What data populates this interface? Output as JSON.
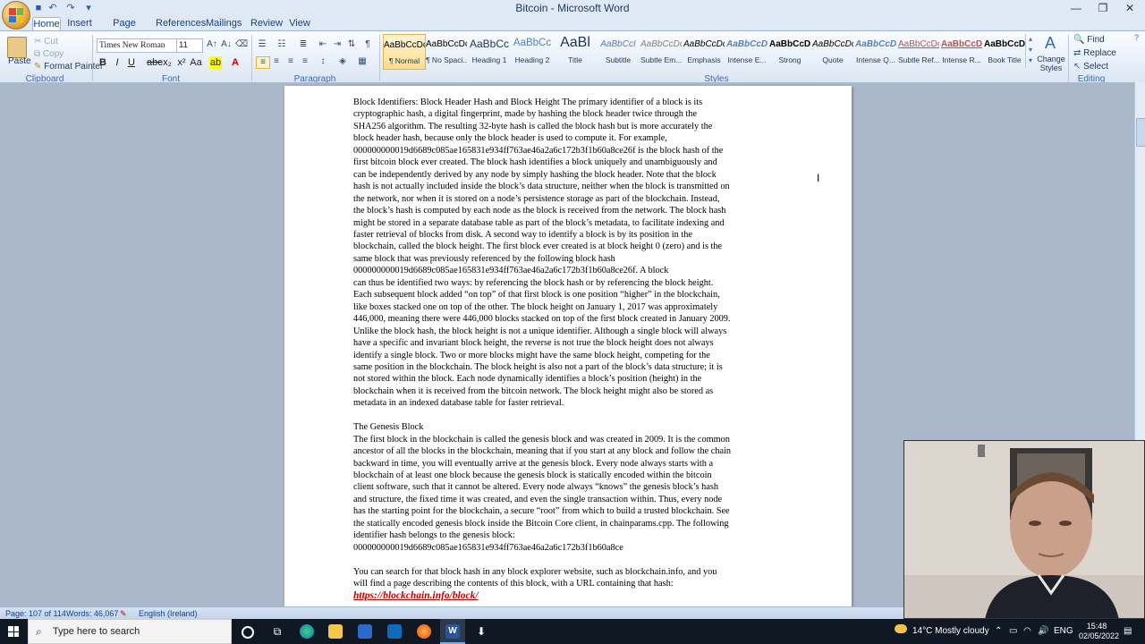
{
  "window": {
    "title": "Bitcoin - Microsoft Word"
  },
  "tabs": [
    {
      "label": "Home",
      "active": true
    },
    {
      "label": "Insert"
    },
    {
      "label": "Page Layout"
    },
    {
      "label": "References"
    },
    {
      "label": "Mailings"
    },
    {
      "label": "Review"
    },
    {
      "label": "View"
    }
  ],
  "clipboard": {
    "paste": "Paste",
    "cut": "Cut",
    "copy": "Copy",
    "format_painter": "Format Painter",
    "label": "Clipboard"
  },
  "font": {
    "name": "Times New Roman",
    "size": "11",
    "label": "Font",
    "bold": "B",
    "italic": "I",
    "underline": "U"
  },
  "paragraph": {
    "label": "Paragraph"
  },
  "styles": {
    "label": "Styles",
    "items": [
      {
        "sample": "AaBbCcDc",
        "name": "¶ Normal",
        "selected": true
      },
      {
        "sample": "AaBbCcDc",
        "name": "¶ No Spaci..."
      },
      {
        "sample": "AaBbCc",
        "name": "Heading 1"
      },
      {
        "sample": "AaBbCc",
        "name": "Heading 2"
      },
      {
        "sample": "AaBl",
        "name": "Title"
      },
      {
        "sample": "AaBbCcI",
        "name": "Subtitle"
      },
      {
        "sample": "AaBbCcDc",
        "name": "Subtle Em..."
      },
      {
        "sample": "AaBbCcDc",
        "name": "Emphasis"
      },
      {
        "sample": "AaBbCcDc",
        "name": "Intense E..."
      },
      {
        "sample": "AaBbCcDc",
        "name": "Strong"
      },
      {
        "sample": "AaBbCcDc",
        "name": "Quote"
      },
      {
        "sample": "AaBbCcDc",
        "name": "Intense Q..."
      },
      {
        "sample": "AaBbCcDc",
        "name": "Subtle Ref..."
      },
      {
        "sample": "AaBbCcDc",
        "name": "Intense R..."
      },
      {
        "sample": "AaBbCcDc",
        "name": "Book Title"
      }
    ],
    "change_styles": "Change Styles"
  },
  "editing": {
    "find": "Find",
    "replace": "Replace",
    "select": "Select",
    "label": "Editing"
  },
  "document": {
    "lines_section1": [
      "Block Identifiers: Block Header Hash and Block Height The primary identifier of a block is its",
      "cryptographic hash, a digital fingerprint, made by hashing the block header twice through the",
      "SHA256 algorithm. The resulting 32-byte hash is called the block hash but is more accurately the",
      "block header hash, because only the block header is used to compute it. For example,",
      "000000000019d6689c085ae165831e934ff763ae46a2a6c172b3f1b60a8ce26f is the block hash of the",
      "first bitcoin block ever created. The block hash identifies a block uniquely and unambiguously and",
      "can be independently derived by any node by simply hashing the block header. Note that the block",
      "hash is not actually included inside the block’s data structure, neither when the block is transmitted on",
      "the network, nor when it is stored on a node’s persistence storage as part of the blockchain. Instead,",
      "the block’s hash is computed by each node as the block is received from the network. The block hash",
      "might be stored in a separate database table as part of the block’s metadata, to facilitate indexing and",
      "faster retrieval of blocks from disk. A second way to identify a block is by its position in the",
      "blockchain, called the block height. The first block ever created is at block height 0 (zero) and is the",
      "same block that was previously referenced by the following block hash",
      "000000000019d6689c085ae165831e934ff763ae46a2a6c172b3f1b60a8ce26f. A block",
      "can thus be identified two ways: by referencing the block hash or by referencing the block height.",
      "Each subsequent block added “on top” of that first block is one position “higher” in the blockchain,",
      "like boxes stacked one on top of the other. The block height on January 1, 2017 was approximately",
      "446,000, meaning there were 446,000 blocks stacked on top of the first block created in January 2009.",
      "Unlike the block hash, the block height is not a unique identifier. Although a single block will always",
      "have a specific and invariant block height, the reverse is not true the block height does not always",
      "identify a single block. Two or more blocks might have the same block height, competing for the",
      "same position in the blockchain. The block height is also not a part of the block’s data structure; it is",
      "not stored within the block. Each node dynamically identifies a block’s position (height) in the",
      "blockchain when it is received from the bitcoin network. The block height might also be stored as",
      "metadata in an indexed database table for faster retrieval."
    ],
    "heading2": "The Genesis Block",
    "lines_section2": [
      "The first block in the blockchain is called the genesis block and was created in 2009. It is the common",
      "ancestor of all the blocks in the blockchain, meaning that if you start at any block and follow the chain",
      "backward in time, you will eventually arrive at the genesis block. Every node always starts with a",
      "blockchain of at least one block because the genesis block is statically encoded within the bitcoin",
      "client software, such that it cannot be altered. Every node always “knows” the genesis block’s hash",
      "and structure, the fixed time it was created, and even the single transaction within. Thus, every node",
      "has the starting point for the blockchain, a secure “root” from which to build a trusted blockchain. See",
      "the statically encoded genesis block inside the Bitcoin Core client, in chainparams.cpp. The following",
      "identifier hash belongs to the genesis block:",
      "000000000019d6689c085ae165831e934ff763ae46a2a6c172b3f1b60a8ce"
    ],
    "lines_section3": [
      "You can search for that block hash in any block explorer website, such as blockchain.info, and you",
      "will find a page describing the contents of this block, with a URL containing that hash:"
    ],
    "link": "https://blockchain.info/block/"
  },
  "status": {
    "page": "Page: 107 of 114",
    "words": "Words: 46,067",
    "language": "English (Ireland)"
  },
  "taskbar": {
    "search_placeholder": "Type here to search",
    "weather": "14°C  Mostly cloudy",
    "lang": "ENG",
    "time": "15:48",
    "date": "02/05/2022"
  },
  "colors": {
    "ribbon_bg": "#dbe6f4",
    "doc_bg": "#abb8cc",
    "link": "#c00000",
    "taskbar": "#101824"
  }
}
